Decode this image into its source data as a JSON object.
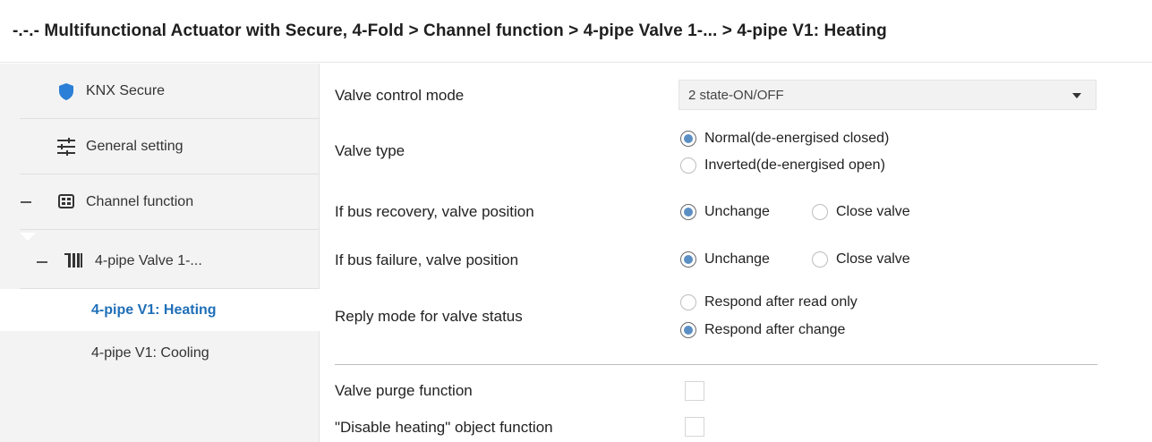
{
  "breadcrumb": {
    "text": "-.-.- Multifunctional Actuator with Secure, 4-Fold > Channel function > 4-pipe Valve 1-... > 4-pipe V1: Heating"
  },
  "sidebar": {
    "items": [
      {
        "label": "KNX Secure",
        "icon": "shield-icon"
      },
      {
        "label": "General setting",
        "icon": "sliders-icon"
      },
      {
        "label": "Channel function",
        "icon": "channel-grid-icon",
        "collapse": "-"
      },
      {
        "label": "4-pipe Valve 1-...",
        "icon": "radiator-icon",
        "collapse": "-"
      },
      {
        "label": "4-pipe V1: Heating",
        "active": true
      },
      {
        "label": "4-pipe V1: Cooling"
      }
    ]
  },
  "params": {
    "valve_control_mode": {
      "label": "Valve control mode",
      "value": "2 state-ON/OFF"
    },
    "valve_type": {
      "label": "Valve type",
      "options": [
        "Normal(de-energised closed)",
        "Inverted(de-energised open)"
      ],
      "selected": 0
    },
    "bus_recovery": {
      "label": "If bus recovery, valve position",
      "options": [
        "Unchange",
        "Close valve"
      ],
      "selected": 0
    },
    "bus_failure": {
      "label": "If bus failure, valve position",
      "options": [
        "Unchange",
        "Close valve"
      ],
      "selected": 0
    },
    "reply_mode": {
      "label": "Reply mode for valve status",
      "options": [
        "Respond after read only",
        "Respond after change"
      ],
      "selected": 1
    },
    "valve_purge": {
      "label": "Valve purge function",
      "checked": false
    },
    "disable_heating": {
      "label": "\"Disable heating\" object function",
      "checked": false
    }
  },
  "colors": {
    "accent": "#1f6fb8",
    "radio_selected": "#5b8fc4",
    "shield": "#2b7fd6"
  }
}
